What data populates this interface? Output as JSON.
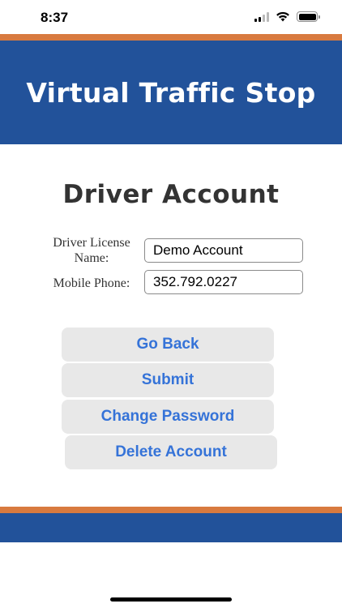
{
  "status_bar": {
    "time": "8:37",
    "icons": [
      "cellular-signal-icon",
      "wifi-icon",
      "battery-icon"
    ]
  },
  "header": {
    "title": "Virtual Traffic Stop"
  },
  "page": {
    "title": "Driver Account"
  },
  "form": {
    "license_name_label": "Driver License Name:",
    "license_name_value": "Demo Account",
    "phone_label": "Mobile Phone:",
    "phone_value": "352.792.0227"
  },
  "buttons": {
    "go_back": "Go Back",
    "submit": "Submit",
    "change_password": "Change Password",
    "delete_account": "Delete Account"
  },
  "colors": {
    "brand_blue": "#22529a",
    "accent_orange": "#d87a3f",
    "button_text": "#3573d8",
    "button_bg": "#e8e8e8"
  }
}
